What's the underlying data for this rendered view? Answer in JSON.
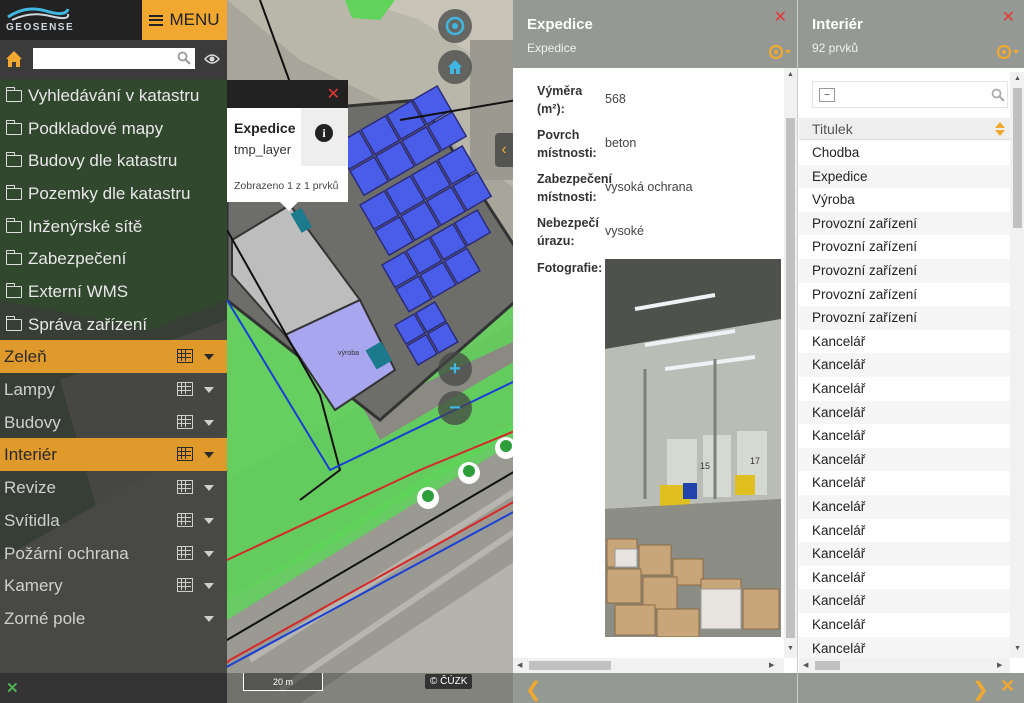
{
  "colors": {
    "accent": "#f0a830",
    "active_layer": "#e09a2c",
    "close": "#e53935",
    "green_map": "#5fd35a",
    "blue_panels": "#4a5de8"
  },
  "app": {
    "logo_text": "GEOSENSE",
    "menu_label": "MENU"
  },
  "search": {
    "placeholder": "",
    "value": ""
  },
  "folders": [
    {
      "label": "Vyhledávání v katastru",
      "icon": "folder-icon"
    },
    {
      "label": "Podkladové mapy",
      "icon": "folder-icon"
    },
    {
      "label": "Budovy dle katastru",
      "icon": "folder-icon"
    },
    {
      "label": "Pozemky dle katastru",
      "icon": "folder-icon"
    },
    {
      "label": "Inženýrské sítě",
      "icon": "folder-icon"
    },
    {
      "label": "Zabezpečení",
      "icon": "folder-icon"
    },
    {
      "label": "Externí WMS",
      "icon": "folder-icon"
    },
    {
      "label": "Správa zařízení",
      "icon": "folder-icon"
    }
  ],
  "layers": [
    {
      "label": "Zeleň",
      "active": true,
      "has_table": true
    },
    {
      "label": "Lampy",
      "active": false,
      "has_table": true
    },
    {
      "label": "Budovy",
      "active": false,
      "has_table": true
    },
    {
      "label": "Interiér",
      "active": true,
      "has_table": true
    },
    {
      "label": "Revize",
      "active": false,
      "has_table": true
    },
    {
      "label": "Svítidla",
      "active": false,
      "has_table": true
    },
    {
      "label": "Požární ochrana",
      "active": false,
      "has_table": true
    },
    {
      "label": "Kamery",
      "active": false,
      "has_table": true
    },
    {
      "label": "Zorné pole",
      "active": false,
      "has_table": false
    }
  ],
  "map": {
    "scale_label": "20 m",
    "attribution": "© ČÚZK",
    "room_label": "výroba"
  },
  "popup": {
    "title": "Expedice",
    "subtitle": "tmp_layer",
    "count_text": "Zobrazeno 1 z 1 prvků",
    "close": "✕",
    "info": "i"
  },
  "detail": {
    "title": "Expedice",
    "subtitle": "Expedice",
    "close": "✕",
    "back": "❮",
    "properties": [
      {
        "label": "Výměra (m²):",
        "value": "568"
      },
      {
        "label": "Povrch místnosti:",
        "value": "beton"
      },
      {
        "label": "Zabezpečení místnosti:",
        "value": "vysoká ochrana"
      },
      {
        "label": "Nebezpečí úrazu:",
        "value": "vysoké"
      },
      {
        "label": "Fotografie:",
        "value": ""
      }
    ],
    "photo_numbers": [
      "15",
      "17"
    ]
  },
  "list": {
    "title": "Interiér",
    "subtitle": "92 prvků",
    "close": "✕",
    "filter_caret": "~",
    "column": "Titulek",
    "next": "❯",
    "close_bottom": "✕",
    "rows": [
      "Chodba",
      "Expedice",
      "Výroba",
      "Provozní zařízení",
      "Provozní zařízení",
      "Provozní zařízení",
      "Provozní zařízení",
      "Provozní zařízení",
      "Kancelář",
      "Kancelář",
      "Kancelář",
      "Kancelář",
      "Kancelář",
      "Kancelář",
      "Kancelář",
      "Kancelář",
      "Kancelář",
      "Kancelář",
      "Kancelář",
      "Kancelář",
      "Kancelář",
      "Kancelář"
    ]
  },
  "bottom_left": {
    "close": "✕"
  }
}
